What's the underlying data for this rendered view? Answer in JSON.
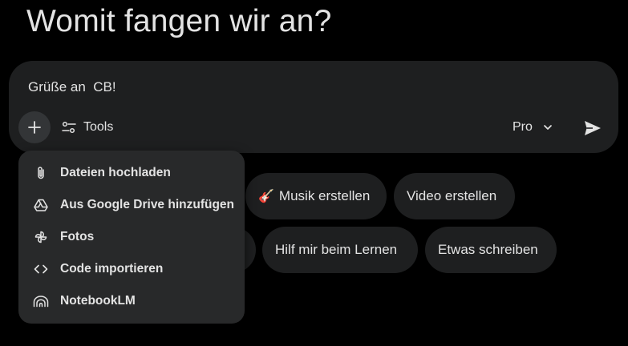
{
  "heading": "Womit fangen wir an?",
  "composer": {
    "prompt_text": "Grüße an  CB!",
    "add_button_icon": "plus-icon",
    "tools_label": "Tools",
    "tools_icon": "tune-icon",
    "mode_label": "Pro",
    "mode_icon": "chevron-down-icon",
    "send_icon": "send-icon"
  },
  "suggestions": [
    {
      "label": "Musik erstellen",
      "emoji": "🎸"
    },
    {
      "label": "Video erstellen"
    },
    {
      "label": "Hilf mir beim Lernen"
    },
    {
      "label": "Etwas schreiben"
    }
  ],
  "menu": {
    "items": [
      {
        "label": "Dateien hochladen",
        "icon": "paperclip-icon"
      },
      {
        "label": "Aus Google Drive hinzufügen",
        "icon": "drive-icon"
      },
      {
        "label": "Fotos",
        "icon": "photos-icon"
      },
      {
        "label": "Code importieren",
        "icon": "code-icon"
      },
      {
        "label": "NotebookLM",
        "icon": "notebooklm-icon"
      }
    ]
  },
  "colors": {
    "background": "#000000",
    "surface": "#1e1f20",
    "menu_surface": "#28292a",
    "text": "#e3e3e3"
  }
}
